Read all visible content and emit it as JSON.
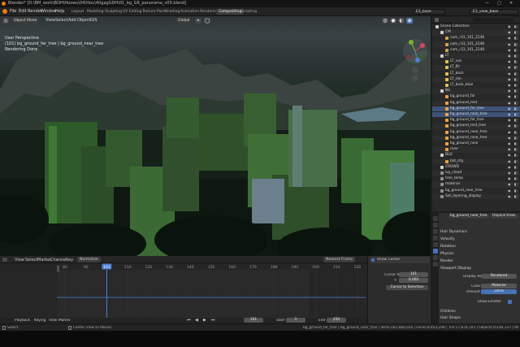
{
  "window": {
    "title": "Blender* [D:\\BM_work\\BDH\\Hoowu\\04\\Hou\\40gagGDH\\01_bg_GR_panorama_v05.blend]",
    "minimize": "—",
    "maximize": "□",
    "close": "✕"
  },
  "menus": [
    "File",
    "Edit",
    "Render",
    "Window",
    "Help"
  ],
  "workspaces": [
    {
      "label": "Layout",
      "active": false
    },
    {
      "label": "Modeling",
      "active": false
    },
    {
      "label": "Sculpting",
      "active": false
    },
    {
      "label": "UV Editing",
      "active": false
    },
    {
      "label": "Texture Paint",
      "active": false
    },
    {
      "label": "Shading",
      "active": false
    },
    {
      "label": "Animation",
      "active": false
    },
    {
      "label": "Rendering",
      "active": false
    },
    {
      "label": "Compositing",
      "active": true
    },
    {
      "label": "Scripting",
      "active": false
    }
  ],
  "scene": {
    "name": "E1_base",
    "view_layer": "E1_view_base"
  },
  "viewport": {
    "mode": "Object Mode",
    "menus": [
      "View",
      "Select",
      "Add",
      "Object",
      "GIS"
    ],
    "transform": "Global",
    "overlay_lines": [
      "User Perspective",
      "(101) bg_ground_far_tree | bg_ground_near_tree",
      "Rendering Done"
    ]
  },
  "outliner": {
    "header": "Scene Collection",
    "rows": [
      {
        "label": "Scene Collection",
        "indent": 0,
        "color": "#cfcfcf",
        "sel": false
      },
      {
        "label": "CM",
        "indent": 1,
        "color": "#cfcfcf",
        "sel": false
      },
      {
        "label": "cam_r33_101_2248",
        "indent": 2,
        "color": "#d8a24a",
        "sel": false
      },
      {
        "label": "cam_r33_101_2248",
        "indent": 2,
        "color": "#d8a24a",
        "sel": false
      },
      {
        "label": "cam_r33_101_2248",
        "indent": 2,
        "color": "#d8a24a",
        "sel": false
      },
      {
        "label": "LT",
        "indent": 1,
        "color": "#cfcfcf",
        "sel": false
      },
      {
        "label": "LT_sun",
        "indent": 2,
        "color": "#e4c04e",
        "sel": false
      },
      {
        "label": "LT_fill",
        "indent": 2,
        "color": "#e4c04e",
        "sel": false
      },
      {
        "label": "LT_back",
        "indent": 2,
        "color": "#e4c04e",
        "sel": false
      },
      {
        "label": "LT_rim",
        "indent": 2,
        "color": "#e4c04e",
        "sel": false
      },
      {
        "label": "LT_back_blue",
        "indent": 2,
        "color": "#e4c04e",
        "sel": false
      },
      {
        "label": "BG",
        "indent": 1,
        "color": "#cfcfcf",
        "sel": false
      },
      {
        "label": "bg_ground_far",
        "indent": 2,
        "color": "#f0a33c",
        "sel": false
      },
      {
        "label": "bg_ground_mid",
        "indent": 2,
        "color": "#f0a33c",
        "sel": false
      },
      {
        "label": "bg_ground_far_tree",
        "indent": 2,
        "color": "#f0a33c",
        "sel": true
      },
      {
        "label": "bg_ground_near_tree",
        "indent": 2,
        "color": "#f0a33c",
        "sel": true
      },
      {
        "label": "bg_ground_far_tree",
        "indent": 2,
        "color": "#f0a33c",
        "sel": false
      },
      {
        "label": "bg_ground_mid_tree",
        "indent": 2,
        "color": "#f0a33c",
        "sel": false
      },
      {
        "label": "bg_ground_near_tree",
        "indent": 2,
        "color": "#f0a33c",
        "sel": false
      },
      {
        "label": "bg_ground_near_tree",
        "indent": 2,
        "color": "#f0a33c",
        "sel": false
      },
      {
        "label": "bg_ground_near",
        "indent": 2,
        "color": "#f0a33c",
        "sel": false
      },
      {
        "label": "river",
        "indent": 2,
        "color": "#f0a33c",
        "sel": false
      },
      {
        "label": "BLD",
        "indent": 1,
        "color": "#cfcfcf",
        "sel": false
      },
      {
        "label": "bld_city",
        "indent": 2,
        "color": "#f0a33c",
        "sel": false
      },
      {
        "label": "CROWD",
        "indent": 1,
        "color": "#cfcfcf",
        "sel": false
      },
      {
        "label": "ivy_cloud",
        "indent": 1,
        "color": "#8f8f8f",
        "sel": false
      },
      {
        "label": "tree_temp",
        "indent": 1,
        "color": "#8f8f8f",
        "sel": false
      },
      {
        "label": "material",
        "indent": 1,
        "color": "#8f8f8f",
        "sel": false
      },
      {
        "label": "bg_ground_near_tree",
        "indent": 1,
        "color": "#8f8f8f",
        "sel": false
      },
      {
        "label": "Set_layering_display",
        "indent": 1,
        "color": "#8f8f8f",
        "sel": false
      }
    ]
  },
  "properties": {
    "object": "bg_ground_near_tree",
    "tab_label": "tropical trees",
    "sections": [
      "Hair Dynamics",
      "Velocity",
      "Rotation",
      "Physics",
      "Render",
      "Viewport Display"
    ],
    "display_as_label": "Display As",
    "display_as_value": "Rendered",
    "color_label": "Color",
    "color_value": "Material",
    "amount_label": "Amount",
    "amount_value": "100%",
    "amount_fill": 1.0,
    "show_emitter_label": "Show Emitter",
    "subsections": [
      "Children",
      "Hair Shape",
      "Field Weights"
    ]
  },
  "timeline": {
    "menus": [
      "View",
      "Select",
      "Marker",
      "Channel",
      "Key"
    ],
    "mode": "Normalize",
    "ticks": [
      80,
      90,
      101,
      110,
      120,
      130,
      140,
      150,
      160,
      170,
      180,
      190,
      200,
      210,
      220
    ],
    "current_frame": 101,
    "snap": "Nearest Frame",
    "channel_value": "208"
  },
  "sidepanel": {
    "title": "Show Cursor",
    "cursor_x_label": "Cursor X",
    "cursor_x": "101",
    "cursor_y_label": "Y",
    "cursor_y": "0.000",
    "button": "Cursor to Selection"
  },
  "playback": {
    "labels": [
      "Playback",
      "Keying",
      "View",
      "Marker"
    ],
    "frame": "101",
    "start_label": "Start",
    "start": "1",
    "end_label": "End",
    "end": "250"
  },
  "statusbar": {
    "left": "Select",
    "mid": "Center View to Mouse",
    "right": "bg_ground_far_tree | bg_ground_near_tree | Verts:262,680,034 | Faces:8,953,298 | Tris:17,878,103 | Objects:0/148,127 | Mem: 4.82 GiB | 2.83.2"
  },
  "colors": {
    "accent": "#3e5277",
    "playhead": "#4f7fd4",
    "active_tab": "#3d3d3d"
  }
}
